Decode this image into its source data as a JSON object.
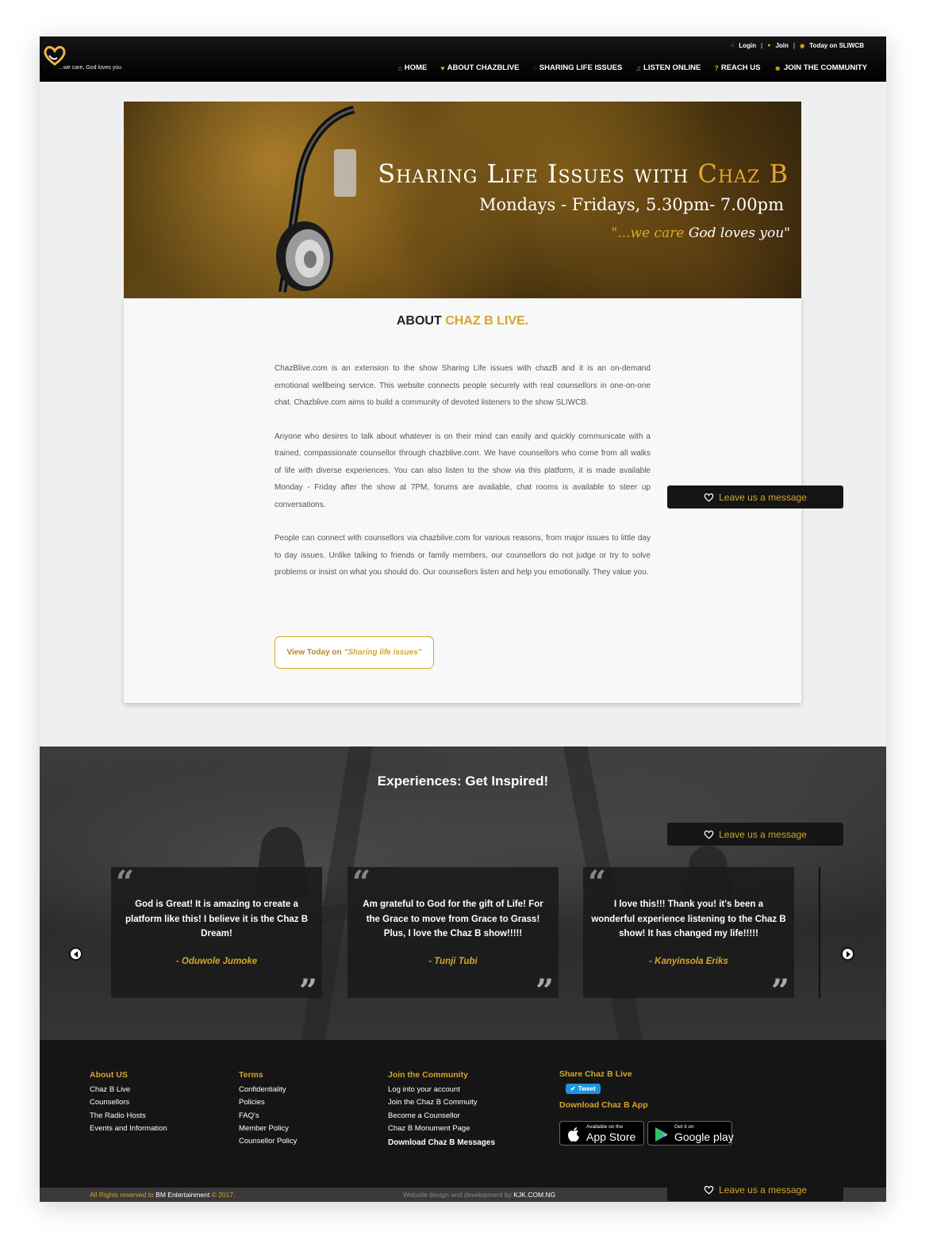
{
  "header": {
    "tagline": "...we care, God loves you",
    "top_links": {
      "login": "Login",
      "join": "Join",
      "today": "Today on SLIWCB",
      "sep": "|"
    },
    "nav": [
      {
        "label": "HOME",
        "icon": "home-icon"
      },
      {
        "label": "ABOUT CHAZBLIVE",
        "icon": "heart-icon"
      },
      {
        "label": "SHARING LIFE ISSUES",
        "icon": "chat-icon"
      },
      {
        "label": "LISTEN ONLINE",
        "icon": "headphones-icon"
      },
      {
        "label": "REACH US",
        "icon": "question-icon"
      },
      {
        "label": "JOIN THE COMMUNITY",
        "icon": "group-icon"
      }
    ]
  },
  "banner": {
    "title_main": "Sharing Life Issues with",
    "title_highlight": "Chaz B",
    "schedule": "Mondays - Fridays, 5.30pm- 7.00pm",
    "slogan_a": "\"...we care",
    "slogan_b": "God loves you\""
  },
  "about": {
    "title_a": "ABOUT",
    "title_b": "CHAZ B LIVE.",
    "paragraphs": [
      "ChazBlive.com is an extension to the show Sharing Life issues with chazB and it is an on-demand emotional wellbeing service. This website connects people securely with real counsellors in one-on-one chat. Chazblive.com aims to build a community of devoted listeners to the show SLIWCB.",
      "Anyone who desires to talk about whatever is on their mind can easily and quickly communicate with a trained, compassionate counsellor through chazblive.com. We have counsellors who come from all walks of life with diverse experiences. You can also listen to the show via this platform, it is made available Monday - Friday after the show at 7PM, forums are available, chat rooms is available to steer up conversations.",
      "People can connect with counsellors via chazblive.com for various reasons, from major issues to little day to day issues. Unlike talking to friends or family members, our counsellors do not judge or try to solve problems or insist on what you should do. Our counsellors listen and help you emotionally. They value you."
    ],
    "view_button_a": "View Today on",
    "view_button_b": "\"Sharing life issues\""
  },
  "leave_message": "Leave us a message",
  "experiences": {
    "title": "Experiences: Get Inspired!",
    "quote_open": "“",
    "quote_close": "”",
    "testimonials": [
      {
        "text": "God is Great! It is amazing to create a platform like this! I believe it is the Chaz B Dream!",
        "author": "- Oduwole Jumoke"
      },
      {
        "text": "Am grateful to God for the gift of Life! For the Grace to move from Grace to Grass! Plus, I love the Chaz B show!!!!!",
        "author": "- Tunji Tubi"
      },
      {
        "text": "I love this!!! Thank you! it's been a wonderful experience listening to the Chaz B show! It has changed my life!!!!!",
        "author": "- Kanyinsola Eriks"
      }
    ]
  },
  "footer": {
    "about": {
      "heading": "About US",
      "links": [
        "Chaz B Live",
        "Counsellors",
        "The Radio Hosts",
        "Events and Information"
      ]
    },
    "terms": {
      "heading": "Terms",
      "links": [
        "Confidentiality",
        "Policies",
        "FAQ's",
        "Member Policy",
        "Counsellor Policy"
      ]
    },
    "community": {
      "heading": "Join the Community",
      "links": [
        "Log into your account",
        "Join the Chaz B Commuity",
        "Become a Counsellor",
        "Chaz B Monument Page"
      ],
      "download_messages": "Download Chaz B Messages"
    },
    "share": {
      "heading": "Share Chaz B Live",
      "tweet": "Tweet",
      "download_app": "Download Chaz B App"
    },
    "stores": {
      "apple_small": "Available on the",
      "apple_big": "App Store",
      "google_small": "Get it on",
      "google_big": "Google play"
    }
  },
  "bottom": {
    "rights_a": "All Rights reserved to",
    "rights_owner": "BM Entertainment",
    "rights_b": "© 2017.",
    "design_a": "Website design and development by",
    "design_b": "KJK.COM.NG"
  },
  "colors": {
    "gold": "#d4a62a",
    "dark": "#151515",
    "page_bg": "#efefef"
  }
}
